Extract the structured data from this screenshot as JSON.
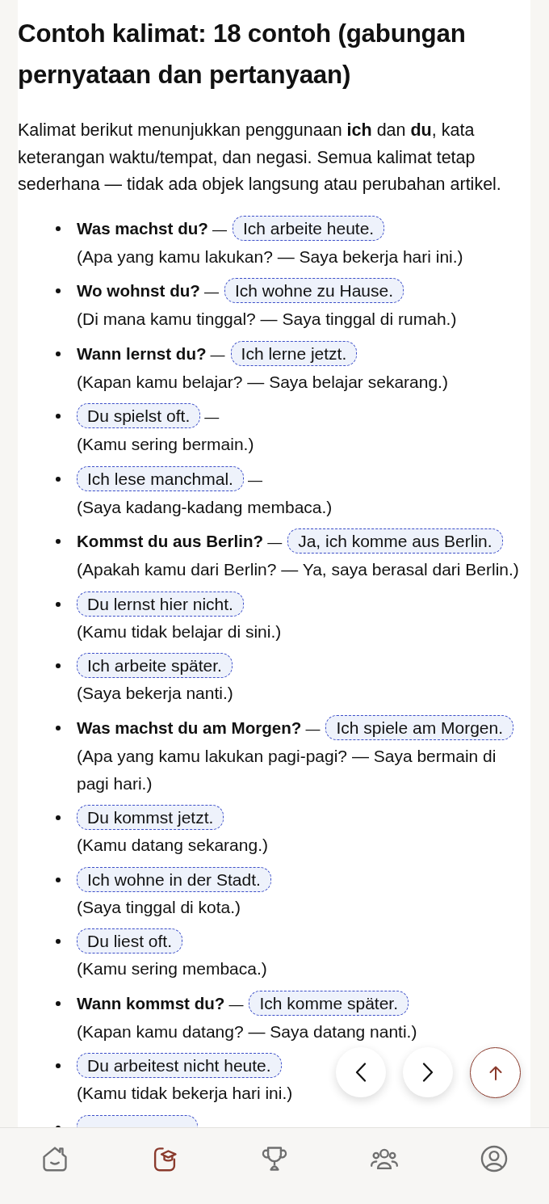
{
  "heading": "Contoh kalimat: 18 contoh (gabungan pernyataan dan pertanyaan)",
  "intro": "Kalimat berikut menunjukkan penggunaan **ich** dan **du**, kata keterangan waktu/tempat, dan negasi. Semua kalimat tetap sederhana — tidak ada objek langsung atau perubahan artikel.",
  "examples": [
    {
      "question": "Was machst du?",
      "separator": "—",
      "answer": "Ich arbeite heute.",
      "translation": "(Apa yang kamu lakukan? — Saya bekerja hari ini.)"
    },
    {
      "question": "Wo wohnst du?",
      "separator": "—",
      "answer": "Ich wohne zu Hause.",
      "translation": "(Di mana kamu tinggal? — Saya tinggal di rumah.)"
    },
    {
      "question": "Wann lernst du?",
      "separator": "—",
      "answer": "Ich lerne jetzt.",
      "translation": "(Kapan kamu belajar? — Saya belajar sekarang.)"
    },
    {
      "answer": "Du spielst oft.",
      "separator": "—",
      "translation": "(Kamu sering bermain.)"
    },
    {
      "answer": "Ich lese manchmal.",
      "separator": "—",
      "translation": "(Saya kadang-kadang membaca.)"
    },
    {
      "question": "Kommst du aus Berlin?",
      "separator": "—",
      "answer": "Ja, ich komme aus Berlin.",
      "translation": "(Apakah kamu dari Berlin? — Ya, saya berasal dari Berlin.)"
    },
    {
      "answer": "Du lernst hier nicht.",
      "translation": "(Kamu tidak belajar di sini.)"
    },
    {
      "answer": "Ich arbeite später.",
      "translation": "(Saya bekerja nanti.)"
    },
    {
      "question": "Was machst du am Morgen?",
      "separator": "—",
      "answer": "Ich spiele am Morgen.",
      "translation": "(Apa yang kamu lakukan pagi-pagi? — Saya bermain di pagi hari.)"
    },
    {
      "answer": "Du kommst jetzt.",
      "translation": "(Kamu datang sekarang.)"
    },
    {
      "answer": "Ich wohne in der Stadt.",
      "translation": "(Saya tinggal di kota.)"
    },
    {
      "answer": "Du liest oft.",
      "translation": "(Kamu sering membaca.)"
    },
    {
      "question": "Wann kommst du?",
      "separator": "—",
      "answer": "Ich komme später.",
      "translation": "(Kapan kamu datang? — Saya datang nanti.)"
    },
    {
      "answer": "Du arbeitest nicht heute.",
      "translation": "(Kamu tidak bekerja hari ini.)"
    }
  ],
  "more_below": true,
  "bottom_nav": {
    "items": [
      {
        "selected": false
      },
      {
        "selected": true
      },
      {
        "selected": false
      },
      {
        "selected": false
      },
      {
        "selected": false
      }
    ]
  }
}
